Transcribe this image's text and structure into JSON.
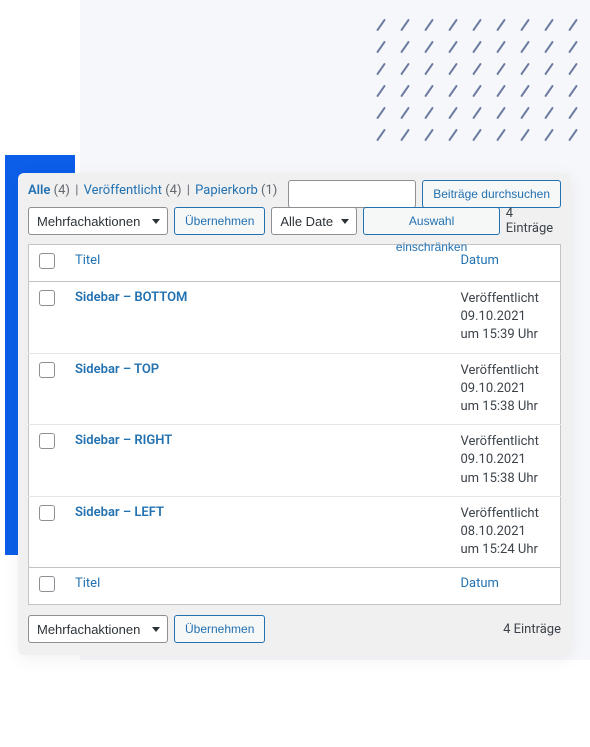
{
  "views": {
    "all_label": "Alle",
    "all_count": "(4)",
    "published_label": "Veröffentlicht",
    "published_count": "(4)",
    "trash_label": "Papierkorb",
    "trash_count": "(1)"
  },
  "search": {
    "button_label": "Beiträge durchsuchen",
    "input_value": ""
  },
  "bulk": {
    "option_label": "Mehrfachaktionen",
    "apply_label": "Übernehmen"
  },
  "filter": {
    "date_option_label": "Alle Daten",
    "restrict_label": "Auswahl einschränken"
  },
  "entries_label": "4 Einträge",
  "columns": {
    "title": "Titel",
    "date": "Datum"
  },
  "rows": [
    {
      "title": "Sidebar – BOTTOM",
      "status": "Veröffentlicht",
      "date": "09.10.2021",
      "time": "um 15:39 Uhr"
    },
    {
      "title": "Sidebar – TOP",
      "status": "Veröffentlicht",
      "date": "09.10.2021",
      "time": "um 15:38 Uhr"
    },
    {
      "title": "Sidebar – RIGHT",
      "status": "Veröffentlicht",
      "date": "09.10.2021",
      "time": "um 15:38 Uhr"
    },
    {
      "title": "Sidebar – LEFT",
      "status": "Veröffentlicht",
      "date": "08.10.2021",
      "time": "um 15:24 Uhr"
    }
  ]
}
